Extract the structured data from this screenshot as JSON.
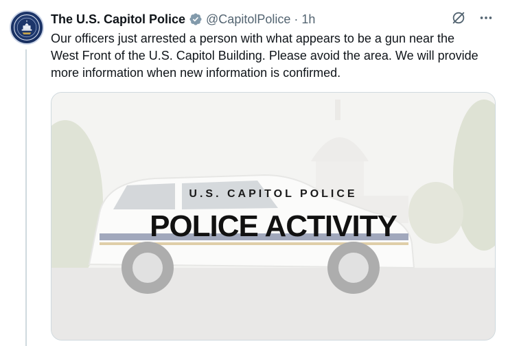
{
  "tweet": {
    "display_name": "The U.S. Capitol Police",
    "handle": "@CapitolPolice",
    "separator": "·",
    "time": "1h",
    "text_lines": [
      "Our officers just arrested a person with what appears to be a gun near the",
      "West Front of the U.S. Capitol Building. Please avoid the area. We will provide",
      "more information when new information is confirmed."
    ]
  },
  "media": {
    "kicker": "U.S. CAPITOL POLICE",
    "headline": "POLICE ACTIVITY"
  },
  "icons": {
    "verified": "verified-badge-icon",
    "grok": "slash-circle-icon",
    "more": "more-icon"
  },
  "colors": {
    "text": "#0f1419",
    "secondary": "#536471",
    "verified": "#829aab",
    "border": "#cfd9de"
  }
}
